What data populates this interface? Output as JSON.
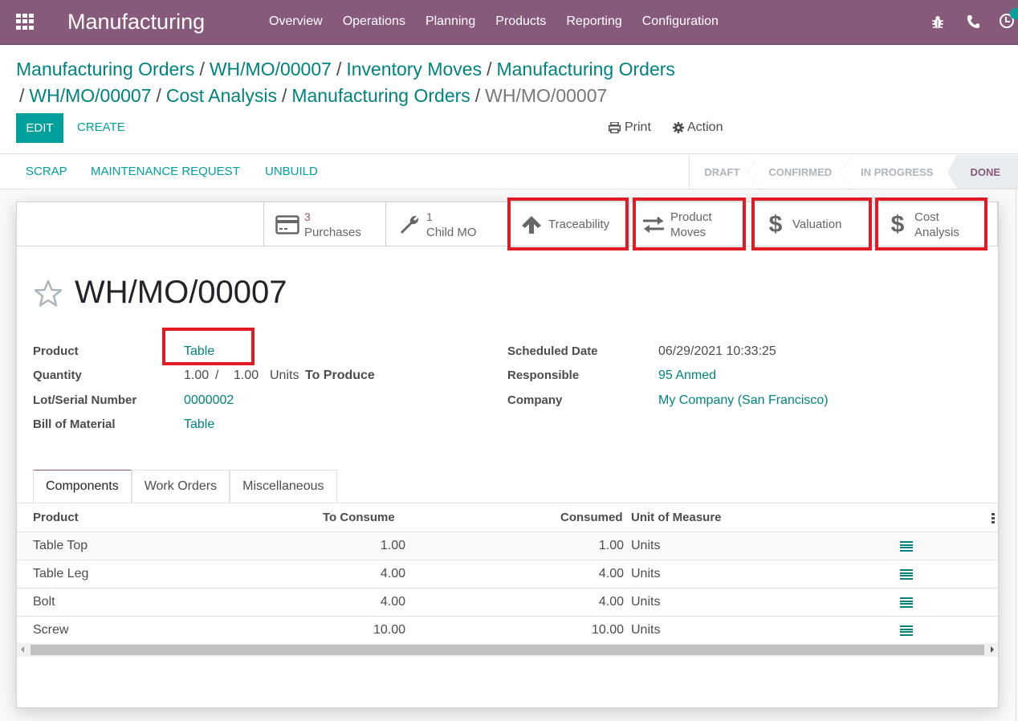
{
  "navbar": {
    "app_name": "Manufacturing",
    "menu": [
      "Overview",
      "Operations",
      "Planning",
      "Products",
      "Reporting",
      "Configuration"
    ],
    "color": "#875a7b"
  },
  "breadcrumb": {
    "items": [
      "Manufacturing Orders",
      "WH/MO/00007",
      "Inventory Moves",
      "Manufacturing Orders",
      "WH/MO/00007",
      "Cost Analysis",
      "Manufacturing Orders"
    ],
    "current": "WH/MO/00007",
    "separator": "/"
  },
  "toolbar": {
    "edit_label": "EDIT",
    "create_label": "CREATE",
    "print_label": "Print",
    "action_label": "Action"
  },
  "header": {
    "buttons": [
      "SCRAP",
      "MAINTENANCE REQUEST",
      "UNBUILD"
    ],
    "stages": [
      "DRAFT",
      "CONFIRMED",
      "IN PROGRESS",
      "DONE"
    ],
    "current_stage": "DONE"
  },
  "smart_buttons": [
    {
      "count": "3",
      "label": "Purchases",
      "icon": "credit-card-icon"
    },
    {
      "count": "1",
      "label": "Child MO",
      "icon": "wrench-icon"
    },
    {
      "label": "Traceability",
      "icon": "arrow-up-icon"
    },
    {
      "label_line1": "Product",
      "label_line2": "Moves",
      "icon": "exchange-icon"
    },
    {
      "label": "Valuation",
      "icon": "dollar-icon"
    },
    {
      "label_line1": "Cost",
      "label_line2": "Analysis",
      "icon": "dollar-icon"
    }
  ],
  "record": {
    "title": "WH/MO/00007",
    "left_fields": {
      "product_label": "Product",
      "product_value": "Table",
      "quantity_label": "Quantity",
      "quantity_done": "1.00",
      "quantity_sep": "/",
      "quantity_total": "1.00",
      "quantity_uom": "Units",
      "quantity_suffix": "To Produce",
      "lot_label": "Lot/Serial Number",
      "lot_value": "0000002",
      "bom_label": "Bill of Material",
      "bom_value": "Table"
    },
    "right_fields": {
      "scheduled_label": "Scheduled Date",
      "scheduled_value": "06/29/2021 10:33:25",
      "responsible_label": "Responsible",
      "responsible_value": "95 Anmed",
      "company_label": "Company",
      "company_value": "My Company (San Francisco)"
    }
  },
  "notebook": {
    "tabs": [
      "Components",
      "Work Orders",
      "Miscellaneous"
    ],
    "active_tab": "Components",
    "columns": [
      "Product",
      "To Consume",
      "Consumed",
      "Unit of Measure"
    ],
    "rows": [
      {
        "product": "Table Top",
        "to_consume": "1.00",
        "consumed": "1.00",
        "uom": "Units"
      },
      {
        "product": "Table Leg",
        "to_consume": "4.00",
        "consumed": "4.00",
        "uom": "Units"
      },
      {
        "product": "Bolt",
        "to_consume": "4.00",
        "consumed": "4.00",
        "uom": "Units"
      },
      {
        "product": "Screw",
        "to_consume": "10.00",
        "consumed": "10.00",
        "uom": "Units"
      }
    ]
  },
  "colors": {
    "primary": "#00a09d",
    "link": "#00827f",
    "brand": "#875a7b",
    "highlight": "#e01b24"
  }
}
